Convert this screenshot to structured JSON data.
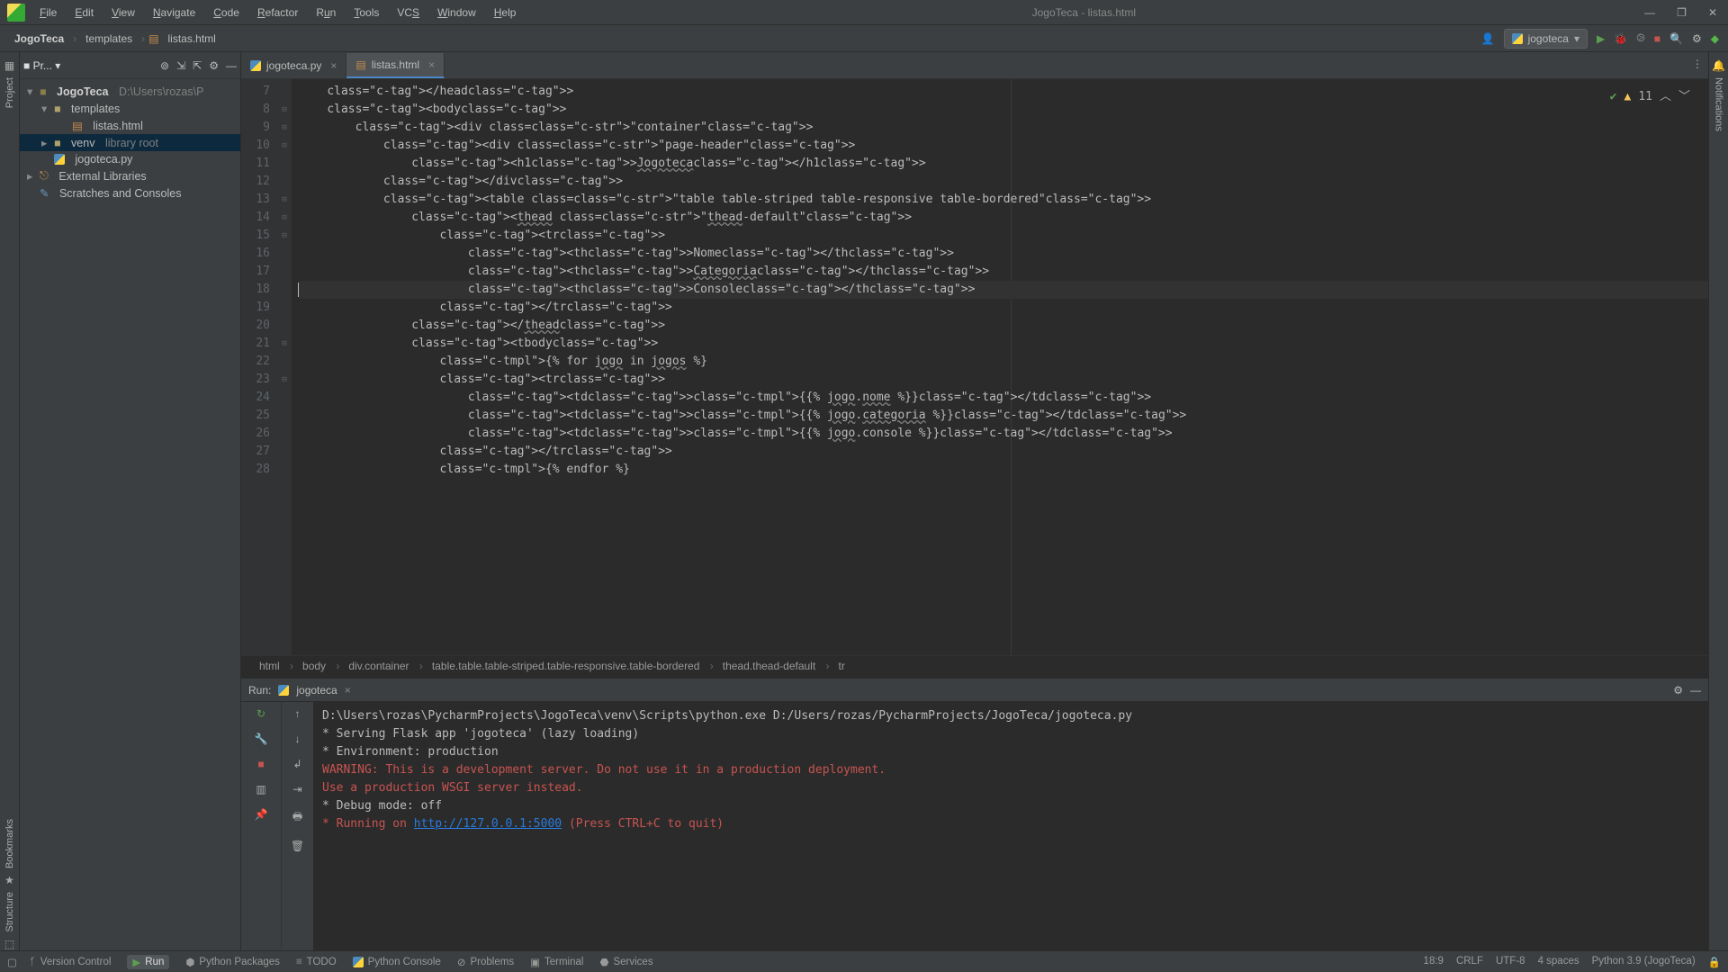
{
  "title": "JogoTeca - listas.html",
  "menu": [
    "File",
    "Edit",
    "View",
    "Navigate",
    "Code",
    "Refactor",
    "Run",
    "Tools",
    "VCS",
    "Window",
    "Help"
  ],
  "breadcrumb": [
    "JogoTeca",
    "templates",
    "listas.html"
  ],
  "run_config": "jogoteca",
  "project": {
    "root": {
      "name": "JogoTeca",
      "path": "D:\\Users\\rozas\\P"
    },
    "children": [
      {
        "kind": "folder",
        "name": "templates",
        "expanded": true,
        "children": [
          {
            "kind": "html",
            "name": "listas.html"
          }
        ]
      },
      {
        "kind": "folder",
        "name": "venv",
        "label": "library root",
        "expanded": false
      },
      {
        "kind": "py",
        "name": "jogoteca.py"
      }
    ],
    "ext_lib": "External Libraries",
    "scratches": "Scratches and Consoles"
  },
  "tabs": [
    {
      "name": "jogoteca.py",
      "active": false,
      "icon": "py"
    },
    {
      "name": "listas.html",
      "active": true,
      "icon": "html"
    }
  ],
  "editor": {
    "first_line": 7,
    "warn_count": "11",
    "lines": [
      "    </head>",
      "    <body>",
      "        <div class=\"container\">",
      "            <div class=\"page-header\">",
      "                <h1>Jogoteca</h1>",
      "            </div>",
      "            <table class=\"table table-striped table-responsive table-bordered\">",
      "                <thead class=\"thead-default\">",
      "                    <tr>",
      "                        <th>Nome</th>",
      "                        <th>Categoria</th>",
      "                        <th>Console</th>",
      "                    </tr>",
      "                </thead>",
      "                <tbody>",
      "                    {% for jogo in jogos %}",
      "                    <tr>",
      "                        <td>{{% jogo.nome %}}</td>",
      "                        <td>{{% jogo.categoria %}}</td>",
      "                        <td>{{% jogo.console %}}</td>",
      "                    </tr>",
      "                    {% endfor %}"
    ],
    "cursor_line": 18,
    "crumb": [
      "html",
      "body",
      "div.container",
      "table.table.table-striped.table-responsive.table-bordered",
      "thead.thead-default",
      "tr"
    ]
  },
  "run": {
    "tab": "jogoteca",
    "lines": [
      {
        "t": "D:\\Users\\rozas\\PycharmProjects\\JogoTeca\\venv\\Scripts\\python.exe D:/Users/rozas/PycharmProjects/JogoTeca/jogoteca.py"
      },
      {
        "t": " * Serving Flask app 'jogoteca' (lazy loading)"
      },
      {
        "t": " * Environment: production"
      },
      {
        "t": "   WARNING: This is a development server. Do not use it in a production deployment.",
        "cls": "red"
      },
      {
        "t": "   Use a production WSGI server instead.",
        "cls": "red"
      },
      {
        "t": " * Debug mode: off"
      },
      {
        "t": " * Running on ",
        "cls": "red",
        "url": "http://127.0.0.1:5000",
        "after": " (Press CTRL+C to quit)"
      }
    ]
  },
  "status": {
    "left": [
      {
        "ico": "branch",
        "label": "Version Control"
      },
      {
        "ico": "play",
        "label": "Run",
        "active": true
      },
      {
        "ico": "pkg",
        "label": "Python Packages"
      },
      {
        "ico": "todo",
        "label": "TODO"
      },
      {
        "ico": "pycon",
        "label": "Python Console"
      },
      {
        "ico": "prob",
        "label": "Problems"
      },
      {
        "ico": "term",
        "label": "Terminal"
      },
      {
        "ico": "svc",
        "label": "Services"
      }
    ],
    "right": [
      "18:9",
      "CRLF",
      "UTF-8",
      "4 spaces",
      "Python 3.9 (JogoTeca)"
    ]
  },
  "left_strips": [
    "Project",
    "Bookmarks",
    "Structure"
  ],
  "right_strip": "Notifications"
}
